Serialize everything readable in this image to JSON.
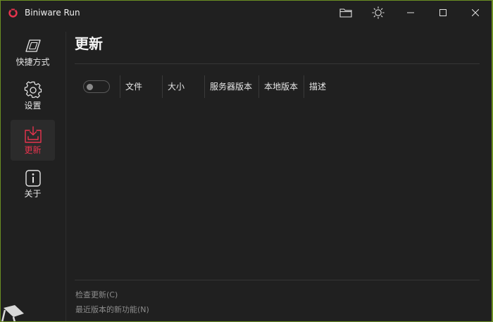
{
  "window": {
    "title": "Biniware Run",
    "accent_color": "#e8344e",
    "background_color": "#202020"
  },
  "titlebar": {
    "buttons": [
      {
        "name": "folder",
        "icon": "folder-icon"
      },
      {
        "name": "theme",
        "icon": "sun-icon"
      },
      {
        "name": "minimize",
        "icon": "minimize-icon"
      },
      {
        "name": "maximize",
        "icon": "maximize-icon"
      },
      {
        "name": "close",
        "icon": "close-icon"
      }
    ]
  },
  "sidebar": {
    "items": [
      {
        "label": "快捷方式",
        "icon": "shortcut-icon",
        "active": false
      },
      {
        "label": "设置",
        "icon": "gear-icon",
        "active": false
      },
      {
        "label": "更新",
        "icon": "download-icon",
        "active": true
      },
      {
        "label": "关于",
        "icon": "info-icon",
        "active": false
      }
    ]
  },
  "main": {
    "title": "更新",
    "table": {
      "select_all_toggle": false,
      "columns": [
        "文件",
        "大小",
        "服务器版本",
        "本地版本",
        "描述"
      ],
      "rows": []
    },
    "footer": {
      "check_updates": "检查更新(C)",
      "whats_new": "最近版本的新功能(N)"
    }
  }
}
